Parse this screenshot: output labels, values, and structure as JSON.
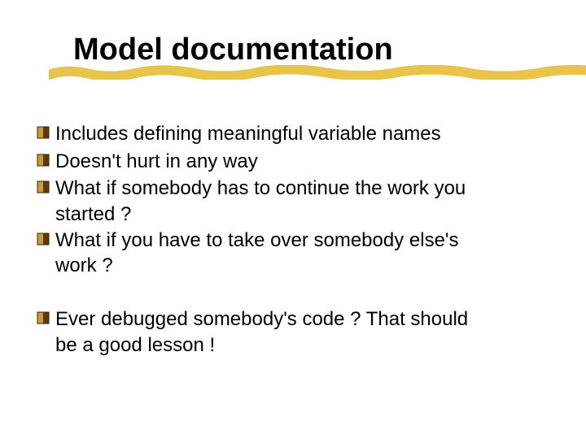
{
  "title": "Model documentation",
  "bullets": {
    "b1": "Includes defining meaningful variable names",
    "b2": "Doesn't hurt in any way",
    "b3a": "What if somebody has to continue the work you",
    "b3b": "started ?",
    "b4a": "What if you have to take over somebody else's",
    "b4b": "work ?",
    "b5a": "Ever debugged somebody's code ? That should",
    "b5b": "be a good lesson !"
  }
}
